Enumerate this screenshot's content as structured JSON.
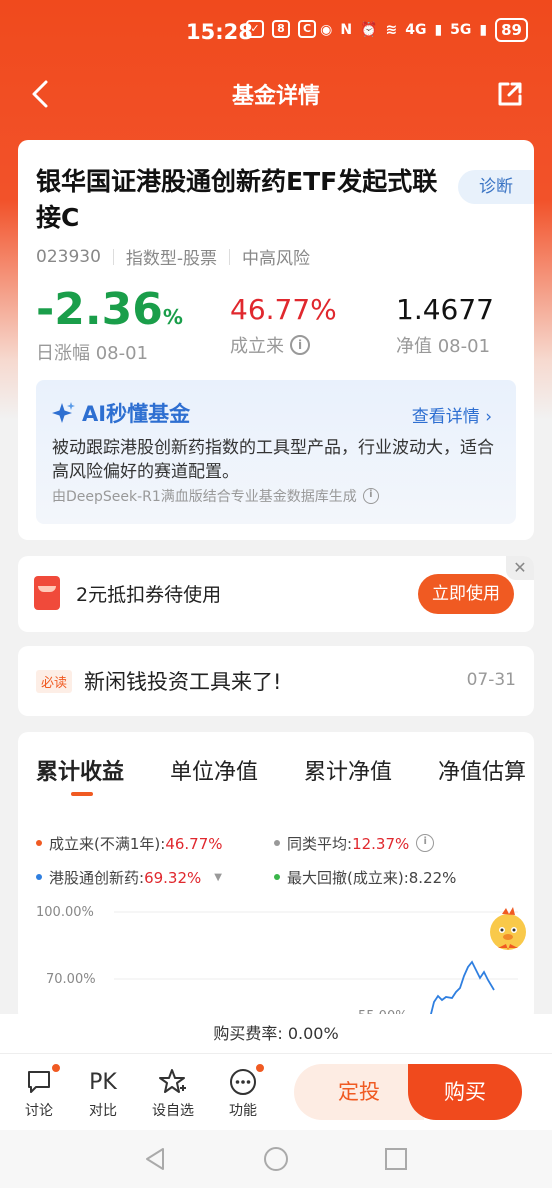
{
  "status_bar": {
    "time": "15:28",
    "network_left": "4G",
    "network_right": "5G",
    "battery": "89"
  },
  "header": {
    "title": "基金详情"
  },
  "fund": {
    "name": "银华国证港股通创新药ETF发起式联接C",
    "diagnose_label": "诊断",
    "code": "023930",
    "type": "指数型-股票",
    "risk": "中高风险",
    "day_change_value": "-2.36",
    "day_change_unit": "%",
    "day_change_label": "日涨幅 08-01",
    "since_inception_value": "46.77%",
    "since_inception_label": "成立来",
    "nav_value": "1.4677",
    "nav_label": "净值 08-01"
  },
  "ai": {
    "title": "AI秒懂基金",
    "more": "查看详情 ›",
    "text": "被动跟踪港股创新药指数的工具型产品，行业波动大，适合高风险偏好的赛道配置。",
    "footer": "由DeepSeek-R1满血版结合专业基金数据库生成"
  },
  "coupon": {
    "text": "2元抵扣券待使用",
    "button": "立即使用",
    "close": "✕"
  },
  "news": {
    "badge": "必读",
    "text": "新闲钱投资工具来了!",
    "date": "07-31"
  },
  "chart_tabs": [
    "累计收益",
    "单位净值",
    "累计净值",
    "净值估算"
  ],
  "legend": {
    "since_label": "成立来(不满1年):",
    "since_value": "46.77%",
    "peer_label": "同类平均:",
    "peer_value": "12.37%",
    "index_label": "港股通创新药:",
    "index_value": "69.32%",
    "drawdown_label": "最大回撤(成立来):",
    "drawdown_value": "8.22%"
  },
  "chart_data": {
    "type": "line",
    "y_ticks": [
      "100.00%",
      "70.00%",
      "55.00%"
    ],
    "series": [
      {
        "name": "港股通创新药",
        "color": "#2f7fe0"
      }
    ],
    "colors": {
      "since": "#f05a22",
      "peer": "#999999",
      "index": "#2f7fe0",
      "drawdown": "#3ab54a"
    }
  },
  "fee": {
    "text": "购买费率: 0.00%"
  },
  "toolbar": {
    "discuss": "讨论",
    "pk_icon": "PK",
    "pk": "对比",
    "watch": "设自选",
    "functions": "功能",
    "auto_invest": "定投",
    "buy": "购买"
  }
}
